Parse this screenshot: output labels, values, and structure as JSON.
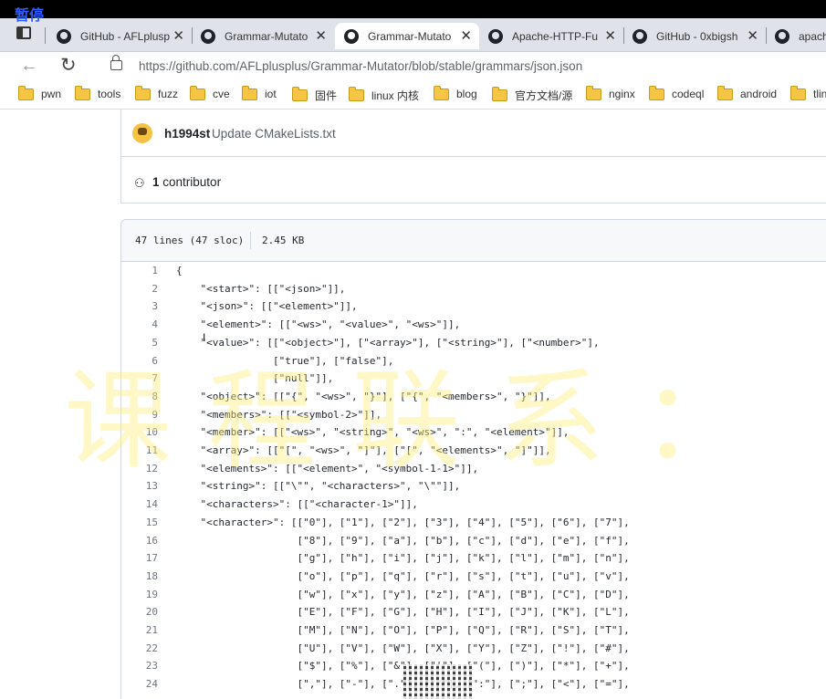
{
  "overlay": {
    "pause_label": "暂停"
  },
  "tabs": [
    {
      "title": "GitHub - AFLplusp",
      "active": false
    },
    {
      "title": "Grammar-Mutato",
      "active": false
    },
    {
      "title": "Grammar-Mutato",
      "active": true
    },
    {
      "title": "Apache-HTTP-Fu",
      "active": false
    },
    {
      "title": "GitHub - 0xbigsh",
      "active": false
    },
    {
      "title": "apach",
      "active": false
    }
  ],
  "address": {
    "url": "https://github.com/AFLplusplus/Grammar-Mutator/blob/stable/grammars/json.json"
  },
  "bookmarks": [
    "pwn",
    "tools",
    "fuzz",
    "cve",
    "iot",
    "固件",
    "linux 内核",
    "blog",
    "官方文档/源",
    "nginx",
    "codeql",
    "android",
    "tlin"
  ],
  "commit": {
    "author": "h1994st",
    "message": "Update CMakeLists.txt"
  },
  "contributors": {
    "count": "1",
    "label": "contributor"
  },
  "file": {
    "lines_info": "47 lines (47 sloc)",
    "size": "2.45 KB"
  },
  "code_lines": [
    "{",
    "    \"<start>\": [[\"<json>\"]],",
    "    \"<json>\": [[\"<element>\"]],",
    "    \"<element>\": [[\"<ws>\", \"<value>\", \"<ws>\"]],",
    "    \"<value>\": [[\"<object>\"], [\"<array>\"], [\"<string>\"], [\"<number>\"],",
    "                [\"true\"], [\"false\"],",
    "                [\"null\"]],",
    "    \"<object>\": [[\"{\", \"<ws>\", \"}\"], [\"{\", \"<members>\", \"}\"]],",
    "    \"<members>\": [[\"<symbol-2>\"]],",
    "    \"<member>\": [[\"<ws>\", \"<string>\", \"<ws>\", \":\", \"<element>\"]],",
    "    \"<array>\": [[\"[\", \"<ws>\", \"]\"], [\"[\", \"<elements>\", \"]\"]],",
    "    \"<elements>\": [[\"<element>\", \"<symbol-1-1>\"]],",
    "    \"<string>\": [[\"\\\"\", \"<characters>\", \"\\\"\"]],",
    "    \"<characters>\": [[\"<character-1>\"]],",
    "    \"<character>\": [[\"0\"], [\"1\"], [\"2\"], [\"3\"], [\"4\"], [\"5\"], [\"6\"], [\"7\"],",
    "                    [\"8\"], [\"9\"], [\"a\"], [\"b\"], [\"c\"], [\"d\"], [\"e\"], [\"f\"],",
    "                    [\"g\"], [\"h\"], [\"i\"], [\"j\"], [\"k\"], [\"l\"], [\"m\"], [\"n\"],",
    "                    [\"o\"], [\"p\"], [\"q\"], [\"r\"], [\"s\"], [\"t\"], [\"u\"], [\"v\"],",
    "                    [\"w\"], [\"x\"], [\"y\"], [\"z\"], [\"A\"], [\"B\"], [\"C\"], [\"D\"],",
    "                    [\"E\"], [\"F\"], [\"G\"], [\"H\"], [\"I\"], [\"J\"], [\"K\"], [\"L\"],",
    "                    [\"M\"], [\"N\"], [\"O\"], [\"P\"], [\"Q\"], [\"R\"], [\"S\"], [\"T\"],",
    "                    [\"U\"], [\"V\"], [\"W\"], [\"X\"], [\"Y\"], [\"Z\"], [\"!\"], [\"#\"],",
    "                    [\"$\"], [\"%\"], [\"&\"], [\"'\"], [\"(\"], [\")\"], [\"*\"], [\"+\"],",
    "                    [\",\"], [\"-\"], [\".\"], [\"/\"], [\":\"], [\";\"], [\"<\"], [\"=\"],"
  ],
  "watermark": "课程联系：",
  "icons": {
    "reload": "reload-icon",
    "back": "back-arrow-icon"
  }
}
